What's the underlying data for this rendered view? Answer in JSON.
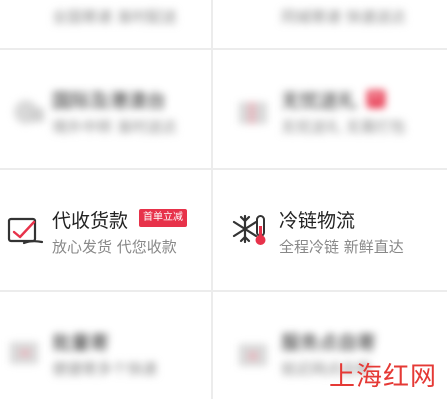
{
  "services": [
    {
      "title": "国际及港澳台",
      "sub": "境外中转 准时送达",
      "badge": ""
    },
    {
      "title": "无忧送礼",
      "sub": "无忧送礼 无需打包",
      "badge": "新"
    },
    {
      "title": "代收货款",
      "sub": "放心发货 代您收款",
      "badge": "首单立减"
    },
    {
      "title": "冷链物流",
      "sub": "全程冷链 新鲜直达",
      "badge": ""
    },
    {
      "title": "批量寄",
      "sub": "便捷寄多个快递",
      "badge": ""
    },
    {
      "title": "服务点自寄",
      "sub": "就近网点自寄",
      "badge": ""
    }
  ],
  "top_row": [
    {
      "sub": "全国寄递 准时配送"
    },
    {
      "sub": "同城寄递 快速送达"
    }
  ],
  "watermark": "上海红网",
  "colors": {
    "badge": "#e7324a",
    "watermark": "#e53935"
  }
}
